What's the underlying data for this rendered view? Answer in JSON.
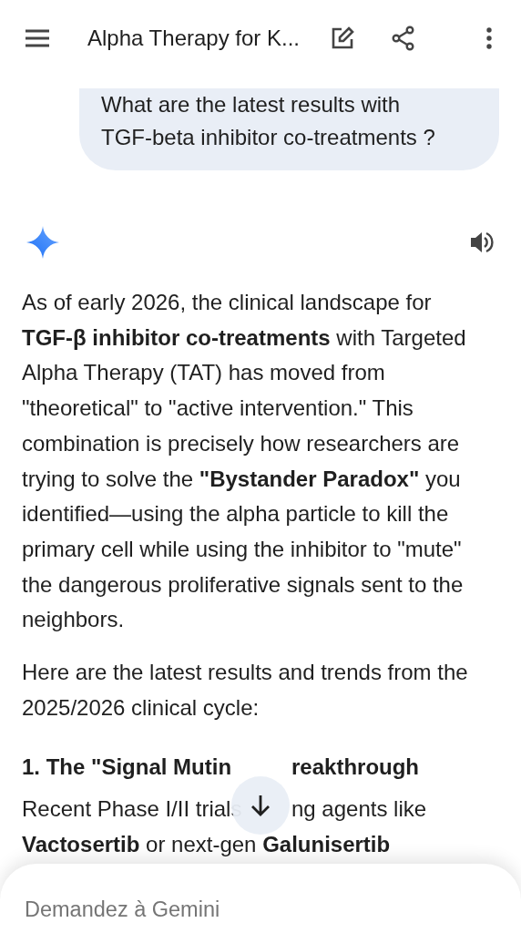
{
  "top_bar": {
    "title": "Alpha Therapy for K..."
  },
  "user_message": {
    "text": "What are the latest results with TGF-beta inhibitor co-treatments ?"
  },
  "response": {
    "paragraphs": [
      {
        "kind": "text",
        "text": "As of early 2026, the clinical landscape for **TGF-β inhibitor co-treatments** with Targeted Alpha Therapy (TAT) has moved from \"theoretical\" to \"active intervention.\" This combination is precisely how researchers are trying to solve the **\"Bystander Paradox\"** you identified—using the alpha particle to kill the primary cell while using the inhibitor to \"mute\" the dangerous proliferative signals sent to the neighbors."
      },
      {
        "kind": "text",
        "text": "Here are the latest results and trends from the 2025/2026 clinical cycle:"
      },
      {
        "kind": "heading",
        "parts": [
          "1. The \"Signal Mutin",
          "reakthrough"
        ]
      },
      {
        "kind": "covered_text",
        "parts": [
          "Recent Phase I/II trials",
          "ng agents like"
        ]
      },
      {
        "kind": "text",
        "text": "**Vactosertib** or next-gen **Galunisertib**"
      }
    ]
  },
  "input": {
    "placeholder": "Demandez à Gemini"
  }
}
